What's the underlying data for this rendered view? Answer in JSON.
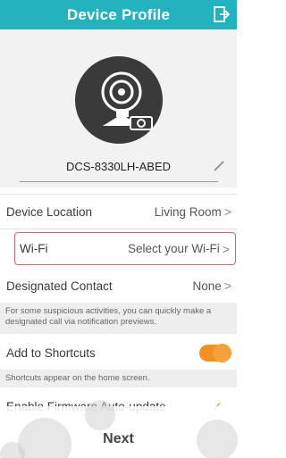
{
  "header": {
    "title": "Device Profile"
  },
  "device": {
    "name": "DCS-8330LH-ABED"
  },
  "rows": {
    "location": {
      "label": "Device Location",
      "value": "Living Room"
    },
    "wifi": {
      "label": "Wi-Fi",
      "value": "Select your Wi-Fi"
    },
    "contact": {
      "label": "Designated Contact",
      "value": "None"
    },
    "contact_note": "For some suspicious activities, you can quickly make a designated call via notification previews.",
    "shortcuts": {
      "label": "Add to Shortcuts",
      "enabled": true
    },
    "shortcuts_note": "Shortcuts appear on the home screen.",
    "firmware": {
      "label": "Enable Firmware Auto-update",
      "enabled": true
    }
  },
  "footer": {
    "next_label": "Next"
  },
  "colors": {
    "accent": "#22b3bf",
    "toggle": "#f29023",
    "highlight_border": "#c56a6a"
  },
  "chevron": ">"
}
